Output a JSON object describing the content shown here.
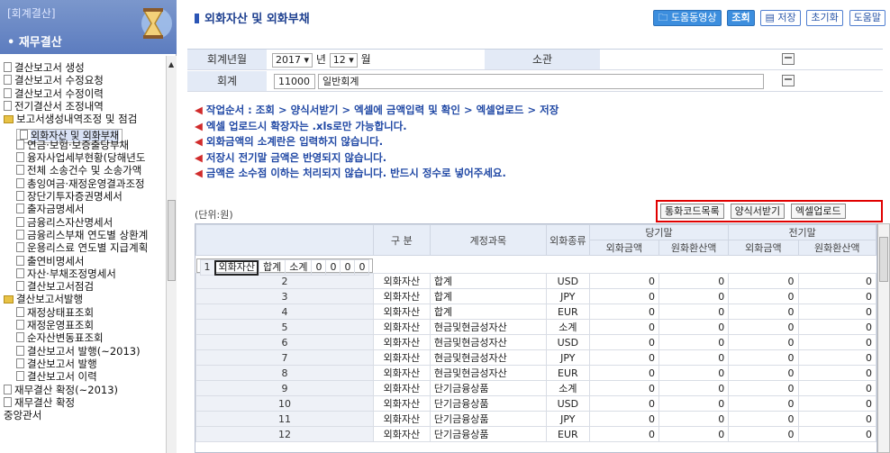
{
  "sidebar": {
    "header_top": "[회계결산]",
    "header_title": "• 재무결산",
    "items": [
      {
        "label": "결산보고서 생성",
        "type": "doc"
      },
      {
        "label": "결산보고서 수정요청",
        "type": "doc"
      },
      {
        "label": "결산보고서 수정이력",
        "type": "doc"
      },
      {
        "label": "전기결산서 조정내역",
        "type": "doc"
      },
      {
        "label": "보고서생성내역조정 및 점검",
        "type": "folder"
      },
      {
        "label": "외화자산 및 외화부채",
        "type": "doc",
        "selected": true
      },
      {
        "label": "연금·보험·보증출당부채",
        "type": "doc"
      },
      {
        "label": "융자사업세부현황(당해년도",
        "type": "doc"
      },
      {
        "label": "전체 소송건수 및 소송가액",
        "type": "doc"
      },
      {
        "label": "총잉여금·재정운영결과조정",
        "type": "doc"
      },
      {
        "label": "장단기투자증권명세서",
        "type": "doc"
      },
      {
        "label": "출자금명세서",
        "type": "doc"
      },
      {
        "label": "금융리스자산명세서",
        "type": "doc"
      },
      {
        "label": "금융리스부채 연도별 상환계",
        "type": "doc"
      },
      {
        "label": "운용리스료 연도별 지급계획",
        "type": "doc"
      },
      {
        "label": "출연비명세서",
        "type": "doc"
      },
      {
        "label": "자산·부채조정명세서",
        "type": "doc"
      },
      {
        "label": "결산보고서점검",
        "type": "doc"
      },
      {
        "label": "결산보고서발행",
        "type": "folder"
      },
      {
        "label": "재정상태표조회",
        "type": "doc"
      },
      {
        "label": "재정운영표조회",
        "type": "doc"
      },
      {
        "label": "순자산변동표조회",
        "type": "doc"
      },
      {
        "label": "결산보고서 발행(~2013)",
        "type": "doc"
      },
      {
        "label": "결산보고서 발행",
        "type": "doc"
      },
      {
        "label": "결산보고서 이력",
        "type": "doc"
      },
      {
        "label": "재무결산 확정(~2013)",
        "type": "doc"
      },
      {
        "label": "재무결산 확정",
        "type": "doc"
      },
      {
        "label": "중앙관서",
        "type": "plain"
      }
    ]
  },
  "page": {
    "title": "외화자산 및 외화부채",
    "buttons": {
      "help_video": "도움동영상",
      "search": "조회",
      "save": "저장",
      "reset": "초기화",
      "help": "도움말"
    }
  },
  "filter": {
    "year_label": "회계년월",
    "year_value": "2017",
    "year_unit": "년",
    "month_value": "12",
    "month_unit": "월",
    "owner_label": "소관",
    "account_label": "회계",
    "account_code": "11000",
    "account_name": "일반회계"
  },
  "notes": [
    "작업순서 : 조회 > 양식서받기 > 엑셀에 금액입력 및 확인 > 엑셀업로드 > 저장",
    "엑셀 업로드시 확장자는 .xls로만 가능합니다.",
    "외화금액의 소계란은 입력하지 않습니다.",
    "저장시 전기말 금액은 반영되지 않습니다.",
    "금액은 소수점 이하는 처리되지 않습니다. 반드시 정수로 넣어주세요."
  ],
  "unit": "(단위:원)",
  "actions": {
    "currency_codes": "통화코드목록",
    "form_download": "양식서받기",
    "excel_upload": "엑셀업로드"
  },
  "grid": {
    "headers": {
      "category": "구 분",
      "account": "계정과목",
      "currency": "외화종류",
      "current": "당기말",
      "previous": "전기말",
      "foreign_amount": "외화금액",
      "won_amount": "원화환산액"
    },
    "rows": [
      {
        "no": "1",
        "cat": "외화자산",
        "acct": "합계",
        "cur": "소계",
        "v1": "0",
        "v2": "0",
        "v3": "0",
        "v4": "0"
      },
      {
        "no": "2",
        "cat": "외화자산",
        "acct": "합계",
        "cur": "USD",
        "v1": "0",
        "v2": "0",
        "v3": "0",
        "v4": "0"
      },
      {
        "no": "3",
        "cat": "외화자산",
        "acct": "합계",
        "cur": "JPY",
        "v1": "0",
        "v2": "0",
        "v3": "0",
        "v4": "0"
      },
      {
        "no": "4",
        "cat": "외화자산",
        "acct": "합계",
        "cur": "EUR",
        "v1": "0",
        "v2": "0",
        "v3": "0",
        "v4": "0"
      },
      {
        "no": "5",
        "cat": "외화자산",
        "acct": "현금및현금성자산",
        "cur": "소계",
        "v1": "0",
        "v2": "0",
        "v3": "0",
        "v4": "0"
      },
      {
        "no": "6",
        "cat": "외화자산",
        "acct": "현금및현금성자산",
        "cur": "USD",
        "v1": "0",
        "v2": "0",
        "v3": "0",
        "v4": "0"
      },
      {
        "no": "7",
        "cat": "외화자산",
        "acct": "현금및현금성자산",
        "cur": "JPY",
        "v1": "0",
        "v2": "0",
        "v3": "0",
        "v4": "0"
      },
      {
        "no": "8",
        "cat": "외화자산",
        "acct": "현금및현금성자산",
        "cur": "EUR",
        "v1": "0",
        "v2": "0",
        "v3": "0",
        "v4": "0"
      },
      {
        "no": "9",
        "cat": "외화자산",
        "acct": "단기금융상품",
        "cur": "소계",
        "v1": "0",
        "v2": "0",
        "v3": "0",
        "v4": "0"
      },
      {
        "no": "10",
        "cat": "외화자산",
        "acct": "단기금융상품",
        "cur": "USD",
        "v1": "0",
        "v2": "0",
        "v3": "0",
        "v4": "0"
      },
      {
        "no": "11",
        "cat": "외화자산",
        "acct": "단기금융상품",
        "cur": "JPY",
        "v1": "0",
        "v2": "0",
        "v3": "0",
        "v4": "0"
      },
      {
        "no": "12",
        "cat": "외화자산",
        "acct": "단기금융상품",
        "cur": "EUR",
        "v1": "0",
        "v2": "0",
        "v3": "0",
        "v4": "0"
      }
    ]
  }
}
